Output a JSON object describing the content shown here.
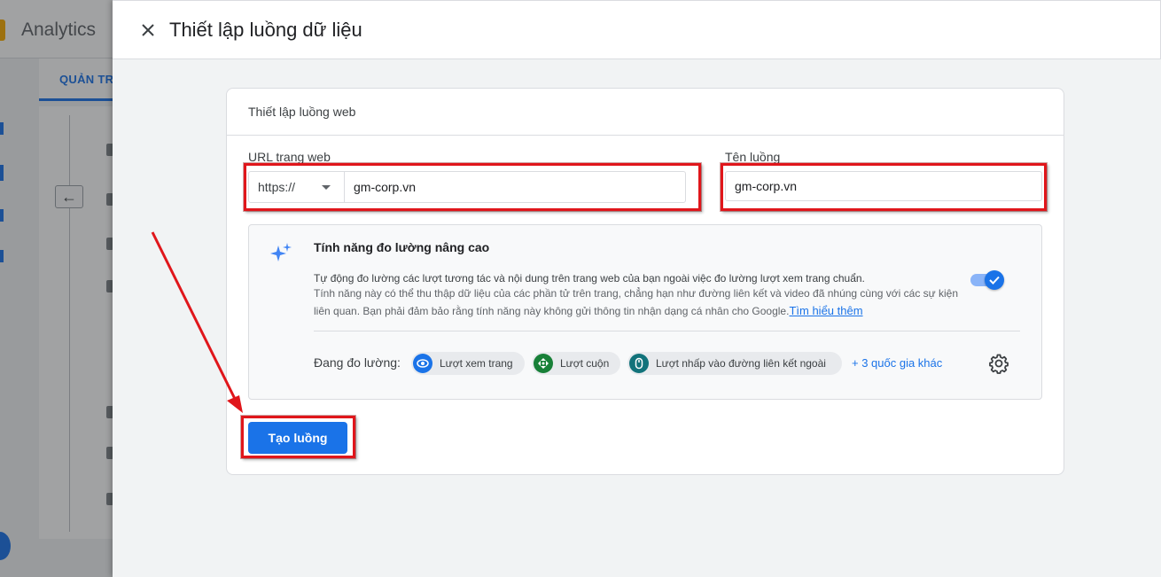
{
  "background": {
    "app_title": "Analytics",
    "admin_tab": "QUẢN TR",
    "back_arrow": "←"
  },
  "dialog": {
    "title": "Thiết lập luồng dữ liệu",
    "close_icon": "close-icon"
  },
  "card": {
    "title": "Thiết lập luồng web",
    "url_label": "URL trang web",
    "protocol": "https://",
    "url_value": "gm-corp.vn",
    "stream_name_label": "Tên luồng",
    "stream_name_value": "gm-corp.vn"
  },
  "enhanced": {
    "title": "Tính năng đo lường nâng cao",
    "description_main": "Tự động đo lường các lượt tương tác và nội dung trên trang web của bạn ngoài việc đo lường lượt xem trang chuẩn.",
    "description_detail": "Tính năng này có thể thu thập dữ liệu của các phần tử trên trang, chẳng hạn như đường liên kết và video đã nhúng cùng với các sự kiện liên quan. Bạn phải đảm bảo rằng tính năng này không gửi thông tin nhận dạng cá nhân cho Google.",
    "learn_more": "Tìm hiểu thêm",
    "toggle_on": true,
    "measuring_label": "Đang đo lường:",
    "chips": [
      {
        "label": "Lượt xem trang",
        "icon": "eye-icon",
        "color": "#1a73e8"
      },
      {
        "label": "Lượt cuộn",
        "icon": "scroll-icon",
        "color": "#188038"
      },
      {
        "label": "Lượt nhấp vào đường liên kết ngoài",
        "icon": "mouse-icon",
        "color": "#12737b"
      }
    ],
    "more": "+ 3 quốc gia khác",
    "settings_icon": "gear-icon"
  },
  "actions": {
    "create_label": "Tạo luồng"
  },
  "colors": {
    "primary": "#1a73e8",
    "annotation_red": "#e0161b"
  }
}
